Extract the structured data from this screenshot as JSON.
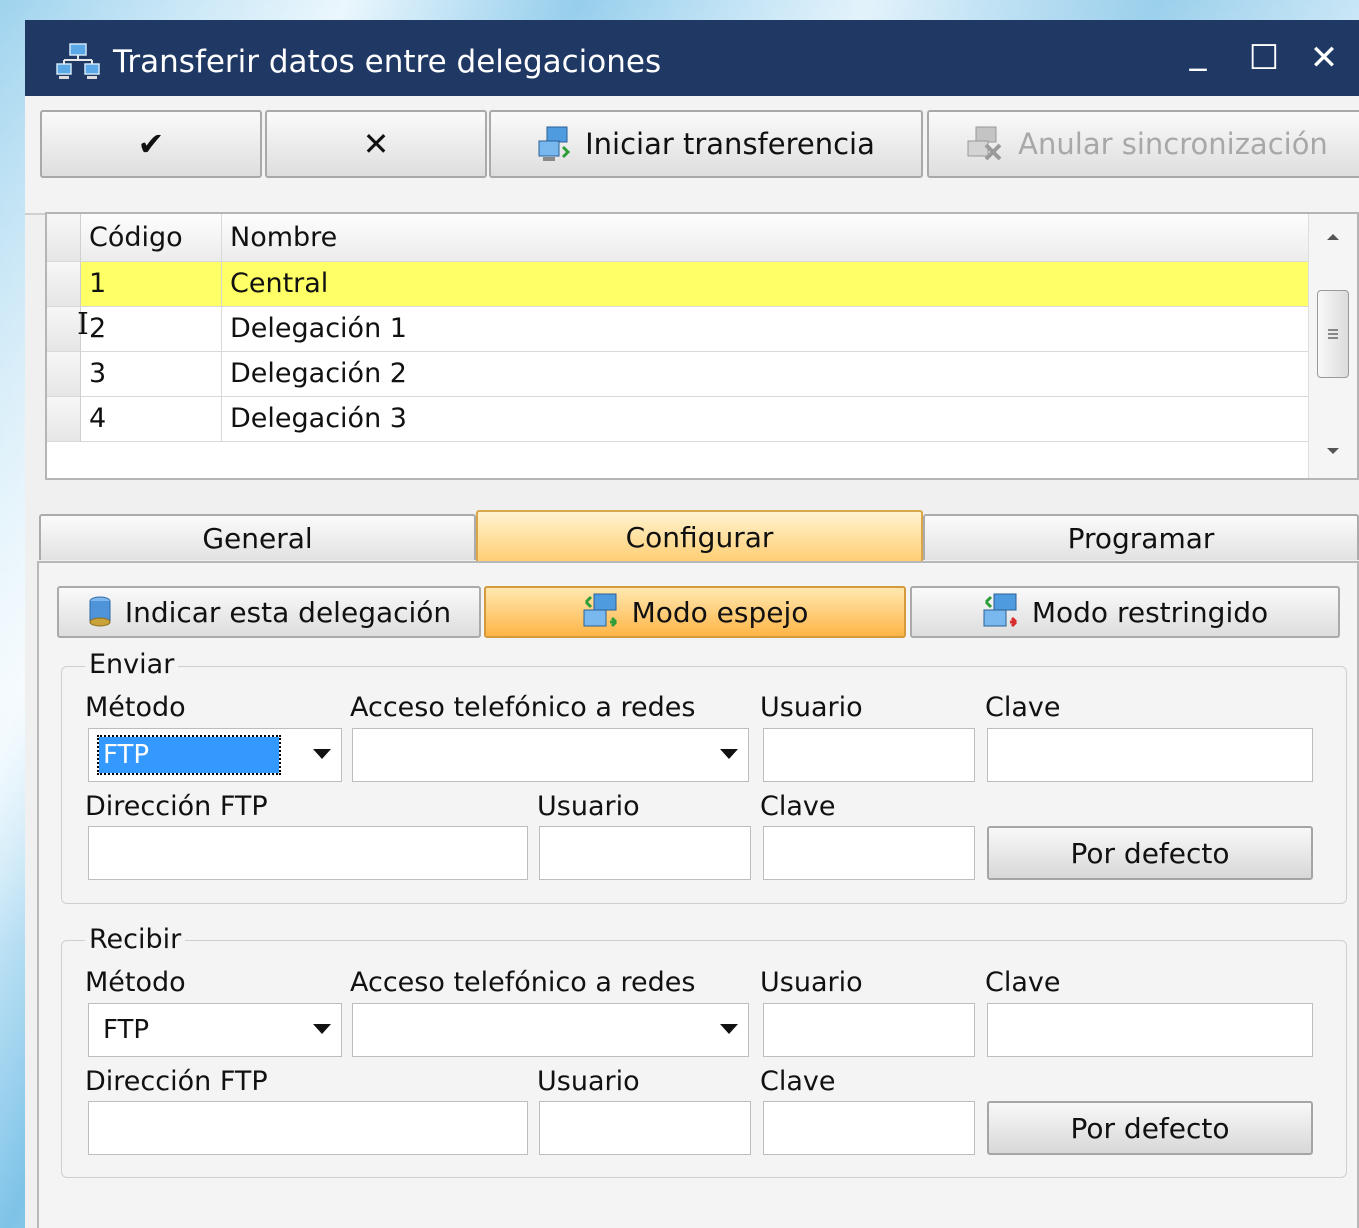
{
  "window": {
    "title": "Transferir datos entre delegaciones"
  },
  "window_controls": {
    "minimize": "_",
    "maximize": "☐",
    "close": "✕"
  },
  "toolbar": {
    "accept": "✔",
    "cancel": "✕",
    "start_transfer": "Iniciar transferencia",
    "cancel_sync": "Anular sincronización"
  },
  "grid": {
    "columns": [
      "Código",
      "Nombre"
    ],
    "rows": [
      {
        "code": "1",
        "name": "Central",
        "selected": true
      },
      {
        "code": "2",
        "name": "Delegación 1"
      },
      {
        "code": "3",
        "name": "Delegación 2"
      },
      {
        "code": "4",
        "name": "Delegación 3"
      }
    ],
    "cursor_glyph": "I"
  },
  "tabs": [
    "General",
    "Configurar",
    "Programar"
  ],
  "active_tab": "Configurar",
  "modes": [
    "Indicar esta delegación",
    "Modo espejo",
    "Modo restringido"
  ],
  "active_mode": "Modo espejo",
  "send": {
    "group_label": "Enviar",
    "method_label": "Método",
    "method_value": "FTP",
    "dialup_label": "Acceso telefónico a redes",
    "dialup_value": "",
    "user_label": "Usuario",
    "user_value": "",
    "password_label": "Clave",
    "password_value": "",
    "ftp_address_label": "Dirección FTP",
    "ftp_address_value": "",
    "ftp_user_label": "Usuario",
    "ftp_user_value": "",
    "ftp_password_label": "Clave",
    "ftp_password_value": "",
    "default_button": "Por defecto"
  },
  "receive": {
    "group_label": "Recibir",
    "method_label": "Método",
    "method_value": "FTP",
    "dialup_label": "Acceso telefónico a redes",
    "dialup_value": "",
    "user_label": "Usuario",
    "user_value": "",
    "password_label": "Clave",
    "password_value": "",
    "ftp_address_label": "Dirección FTP",
    "ftp_address_value": "",
    "ftp_user_label": "Usuario",
    "ftp_user_value": "",
    "ftp_password_label": "Clave",
    "ftp_password_value": "",
    "default_button": "Por defecto"
  },
  "colors": {
    "titlebar": "#1f3864",
    "selected_row": "#ffff66",
    "active_tab": "#ffce73",
    "selection": "#3399ff"
  },
  "icons": {
    "title": "network-computers-icon",
    "start_transfer": "computers-sync-icon",
    "cancel_sync": "computers-cancel-icon",
    "this_delegation": "database-icon",
    "mirror": "computers-sync-green-icon",
    "restricted": "computers-sync-red-icon"
  }
}
